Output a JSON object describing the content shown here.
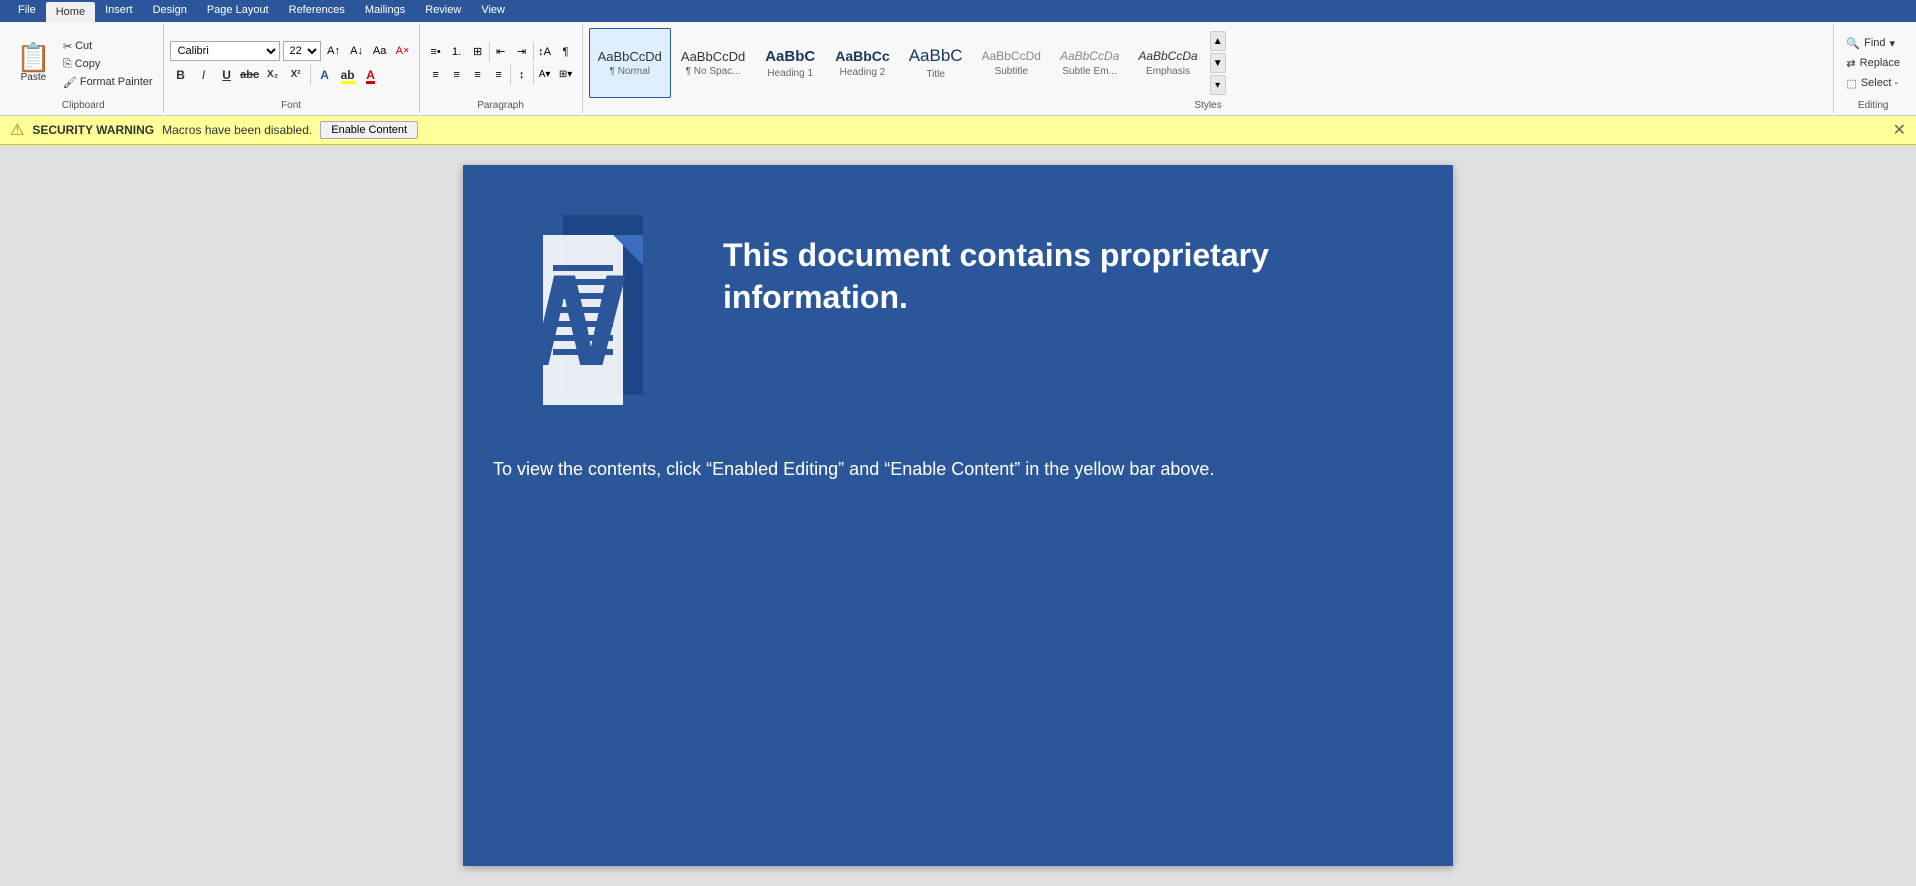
{
  "ribbon": {
    "tabs": [
      "File",
      "Home",
      "Insert",
      "Design",
      "Page Layout",
      "References",
      "Mailings",
      "Review",
      "View"
    ],
    "active_tab": "Home",
    "groups": {
      "clipboard": {
        "label": "Clipboard",
        "paste": "Paste",
        "cut": "Cut",
        "copy": "Copy",
        "format_painter": "Format Painter"
      },
      "font": {
        "label": "Font",
        "font_name": "Calibri",
        "font_size": "22",
        "bold": "B",
        "italic": "I",
        "underline": "U",
        "strikethrough": "abc",
        "subscript": "X₂",
        "superscript": "X²"
      },
      "paragraph": {
        "label": "Paragraph"
      },
      "styles": {
        "label": "Styles",
        "items": [
          {
            "id": "normal",
            "preview": "¶ Normal",
            "label": "¶ Normal",
            "active": true
          },
          {
            "id": "no-spacing",
            "preview": "¶ No Spac...",
            "label": "¶ No Spac...",
            "active": false
          },
          {
            "id": "heading1",
            "preview": "AaBbCc",
            "label": "Heading 1",
            "active": false
          },
          {
            "id": "heading2",
            "preview": "AaBbCc",
            "label": "Heading 2",
            "active": false
          },
          {
            "id": "title",
            "preview": "AaBbC",
            "label": "Title",
            "active": false
          },
          {
            "id": "subtitle",
            "preview": "AaBbCcDd",
            "label": "Subtitle",
            "active": false
          },
          {
            "id": "subtle-em",
            "preview": "AaBbCcDa",
            "label": "Subtle Em...",
            "active": false
          },
          {
            "id": "emphasis",
            "preview": "AaBbCcDa",
            "label": "Emphasis",
            "active": false
          }
        ]
      },
      "editing": {
        "label": "Editing",
        "find": "Find",
        "replace": "Replace",
        "select": "Select -"
      }
    }
  },
  "security_bar": {
    "icon": "⚠",
    "warning_label": "SECURITY WARNING",
    "message": "Macros have been disabled.",
    "button_label": "Enable Content",
    "close_icon": "✕"
  },
  "document": {
    "heading": "This document contains proprietary information.",
    "body_text": "To view the contents, click “Enabled Editing” and “Enable Content” in the yellow bar above."
  }
}
